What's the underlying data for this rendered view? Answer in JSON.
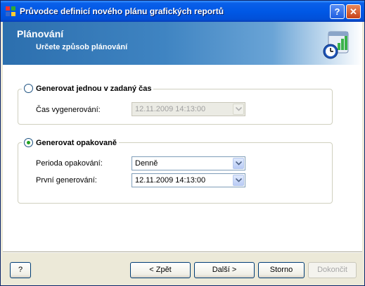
{
  "window": {
    "title": "Průvodce definicí nového plánu grafických reportů"
  },
  "titlebar": {
    "help_label": "?",
    "close_label": "✕"
  },
  "header": {
    "title": "Plánování",
    "subtitle": "Určete způsob plánování",
    "icon": "calendar-clock-chart-icon"
  },
  "once_group": {
    "radio_label": "Generovat jednou v zadaný čas",
    "selected": false,
    "time_label": "Čas vygenerování:",
    "time_value": "12.11.2009 14:13:00",
    "time_enabled": false
  },
  "repeat_group": {
    "radio_label": "Generovat opakovaně",
    "selected": true,
    "period_label": "Perioda opakování:",
    "period_value": "Denně",
    "first_label": "První generování:",
    "first_value": "12.11.2009 14:13:00"
  },
  "footer": {
    "help_label": "?",
    "back_label": "< Zpět",
    "next_label": "Další >",
    "cancel_label": "Storno",
    "finish_label": "Dokončit",
    "finish_enabled": false
  },
  "colors": {
    "title_bar": "#0058e6",
    "header_blue": "#3f84c2",
    "radio_dot": "#21a121",
    "window_bg": "#ece9d8"
  }
}
